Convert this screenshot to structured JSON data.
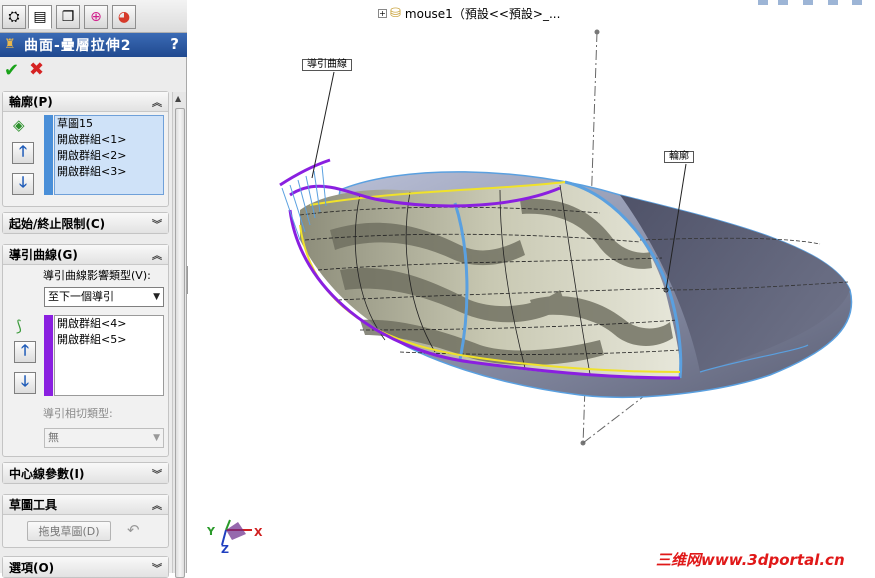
{
  "pm": {
    "title": "曲面-疊層拉伸2",
    "help": "?",
    "ok_label": "✔",
    "cancel_label": "✖",
    "tabs": [
      "feature-manager-tab",
      "property-manager-tab",
      "configuration-manager-tab",
      "dimxpert-tab",
      "display-manager-tab"
    ],
    "profile": {
      "title": "輪廓(P)",
      "items": [
        "草圖15",
        "開啟群組<1>",
        "開啟群組<2>",
        "開啟群組<3>"
      ]
    },
    "start_end": {
      "title": "起始/終止限制(C)"
    },
    "guide": {
      "title": "導引曲線(G)",
      "influence_label": "導引曲線影響類型(V):",
      "influence_value": "至下一個導引",
      "items": [
        "開啟群組<4>",
        "開啟群組<5>"
      ],
      "tangency_label": "導引相切類型:",
      "tangency_value": "無"
    },
    "centerline": {
      "title": "中心線參數(I)"
    },
    "sketch_tools": {
      "title": "草圖工具",
      "drag_label": "拖曳草圖(D)"
    },
    "options": {
      "title": "選項(O)"
    }
  },
  "tree": {
    "label": "mouse1（預設<<預設>_..."
  },
  "view": {
    "annotation_guide": "導引曲線",
    "annotation_profile": "輪廓",
    "triad": {
      "x": "X",
      "y": "Y",
      "z": "Z"
    }
  },
  "watermark": "三维网www.3dportal.cn",
  "colors": {
    "accent_blue": "#2d5ea7",
    "guide_purple": "#8a1fe0",
    "profile_blue": "#5aa0e0",
    "yellow": "#f0e22a"
  }
}
